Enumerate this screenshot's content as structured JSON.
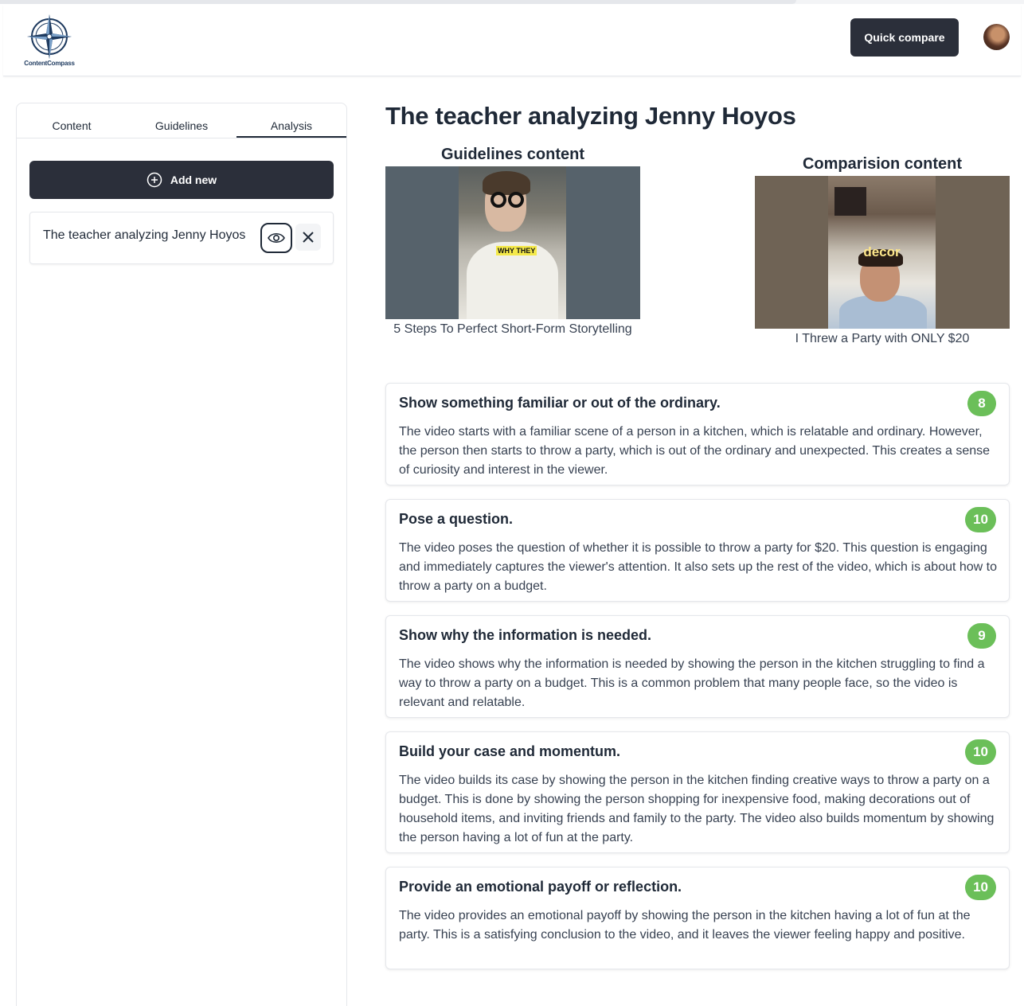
{
  "header": {
    "logo_text": "ContentCompass",
    "quick_compare_label": "Quick compare"
  },
  "sidebar": {
    "tabs": [
      {
        "label": "Content"
      },
      {
        "label": "Guidelines"
      },
      {
        "label": "Analysis",
        "active": true
      }
    ],
    "add_new_label": "Add new",
    "items": [
      {
        "title": "The teacher analyzing Jenny Hoyos"
      }
    ]
  },
  "main": {
    "title": "The teacher analyzing Jenny Hoyos",
    "guidelines": {
      "heading": "Guidelines content",
      "overlay_text": "WHY THEY",
      "caption": "5 Steps To Perfect Short-Form Storytelling"
    },
    "comparison": {
      "heading": "Comparision content",
      "overlay_text": "decor",
      "caption": "I Threw a Party with ONLY $20"
    },
    "criteria": [
      {
        "title": "Show something familiar or out of the ordinary.",
        "score": "8",
        "text": "The video starts with a familiar scene of a person in a kitchen, which is relatable and ordinary. However, the person then starts to throw a party, which is out of the ordinary and unexpected. This creates a sense of curiosity and interest in the viewer."
      },
      {
        "title": "Pose a question.",
        "score": "10",
        "text": "The video poses the question of whether it is possible to throw a party for $20. This question is engaging and immediately captures the viewer's attention. It also sets up the rest of the video, which is about how to throw a party on a budget."
      },
      {
        "title": "Show why the information is needed.",
        "score": "9",
        "text": "The video shows why the information is needed by showing the person in the kitchen struggling to find a way to throw a party on a budget. This is a common problem that many people face, so the video is relevant and relatable."
      },
      {
        "title": "Build your case and momentum.",
        "score": "10",
        "text": "The video builds its case by showing the person in the kitchen finding creative ways to throw a party on a budget. This is done by showing the person shopping for inexpensive food, making decorations out of household items, and inviting friends and family to the party. The video also builds momentum by showing the person having a lot of fun at the party."
      },
      {
        "title": "Provide an emotional payoff or reflection.",
        "score": "10",
        "text": "The video provides an emotional payoff by showing the person in the kitchen having a lot of fun at the party. This is a satisfying conclusion to the video, and it leaves the viewer feeling happy and positive."
      }
    ]
  },
  "colors": {
    "dark_button": "#2b2f3a",
    "score_badge": "#6bbf59"
  },
  "icons": [
    "compass-logo-icon",
    "plus-circle-icon",
    "eye-icon",
    "close-icon"
  ]
}
